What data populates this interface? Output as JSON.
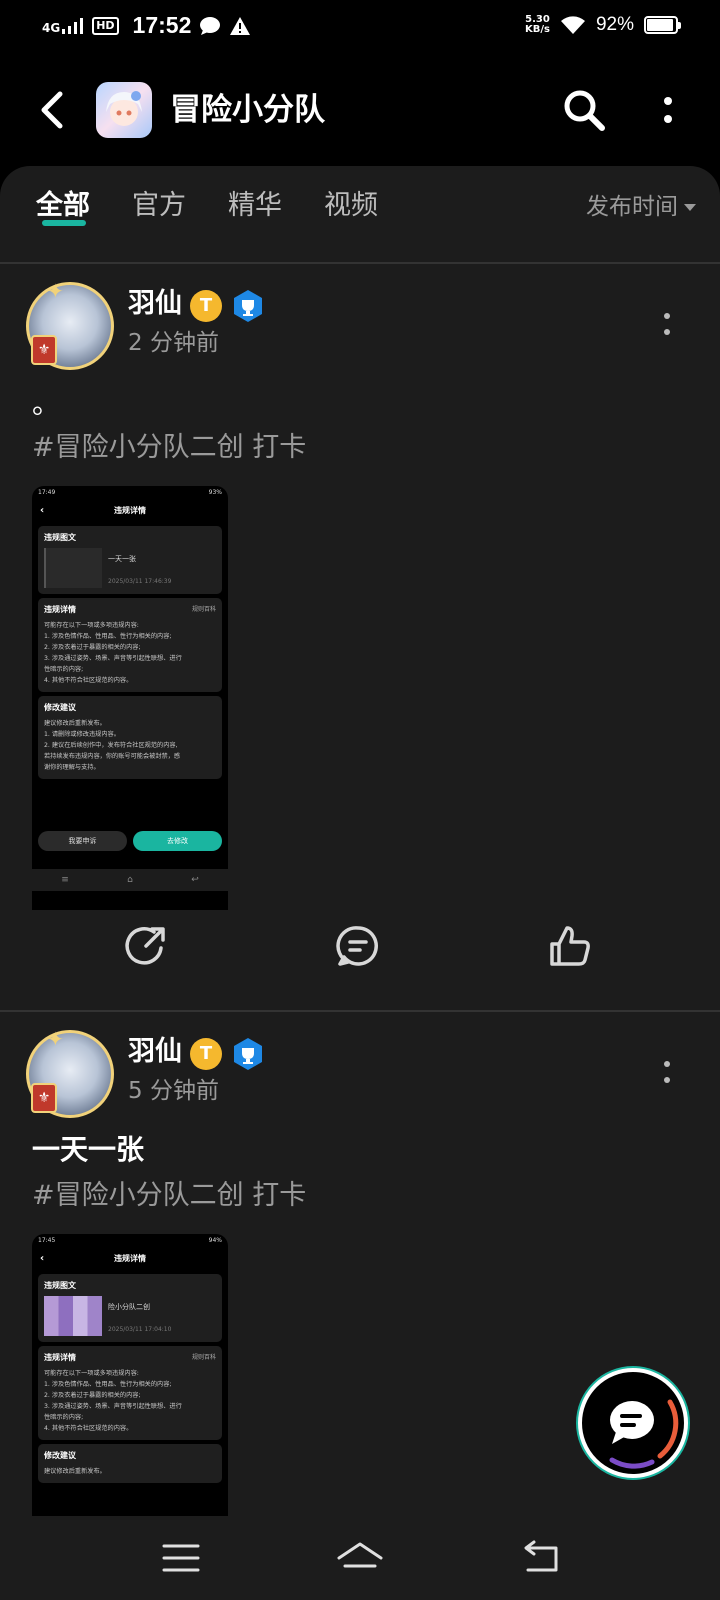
{
  "status_bar": {
    "network": "4G",
    "hd": "HD",
    "time": "17:52",
    "speed_value": "5.30",
    "speed_unit": "KB/s",
    "battery": "92%",
    "battery_level": 0.92
  },
  "header": {
    "title": "冒险小分队"
  },
  "tabs": [
    {
      "label": "全部",
      "active": true
    },
    {
      "label": "官方",
      "active": false
    },
    {
      "label": "精华",
      "active": false
    },
    {
      "label": "视频",
      "active": false
    }
  ],
  "sort": {
    "label": "发布时间"
  },
  "accent_color": "#1ab5a0",
  "posts": [
    {
      "username": "羽仙",
      "user_badge": "T",
      "time": "2 分钟前",
      "text": "。",
      "tag": "#冒险小分队二创 打卡",
      "shot": {
        "status_time": "17:49",
        "status_batt": "93%",
        "title": "违规详情",
        "card1_title": "违规图文",
        "card1_item_title": "一天一张",
        "card1_date": "2025/03/11 17:46:39",
        "card2_title": "违规详情",
        "card2_link": "规则百科",
        "card2_lines": [
          "可能存在以下一项或多项违规内容:",
          "1. 涉及色情作品、性用品、性行为相关的内容;",
          "2. 涉及衣着过于暴露的相关的内容;",
          "3. 涉及通过姿势、场景、声音等引起性联想、进行",
          "性暗示的内容;",
          "4. 其他不符合社区规范的内容。"
        ],
        "card3_title": "修改建议",
        "card3_lines": [
          "建议修改后重新发布。",
          "1. 请删除或修改违规内容。",
          "2. 建议在后续创作中，发布符合社区规范的内容,",
          "若持续发布违规内容，你的账号可能会被封禁，感",
          "谢你的理解与支持。"
        ],
        "btn_appeal": "我要申诉",
        "btn_edit": "去修改"
      }
    },
    {
      "username": "羽仙",
      "user_badge": "T",
      "time": "5 分钟前",
      "text": "一天一张",
      "tag": "#冒险小分队二创 打卡",
      "shot": {
        "status_time": "17:45",
        "status_batt": "94%",
        "title": "违规详情",
        "card1_title": "违规图文",
        "card1_item_title": "险小分队二创",
        "card1_date": "2025/03/11 17:04:10",
        "card2_title": "违规详情",
        "card2_link": "规则百科",
        "card2_lines": [
          "可能存在以下一项或多项违规内容:",
          "1. 涉及色情作品、性用品、性行为相关的内容;",
          "2. 涉及衣着过于暴露的相关的内容;",
          "3. 涉及通过姿势、场景、声音等引起性联想、进行",
          "性暗示的内容;",
          "4. 其他不符合社区规范的内容。"
        ],
        "card3_title": "修改建议",
        "card3_lines": [
          "建议修改后重新发布。"
        ]
      }
    }
  ]
}
